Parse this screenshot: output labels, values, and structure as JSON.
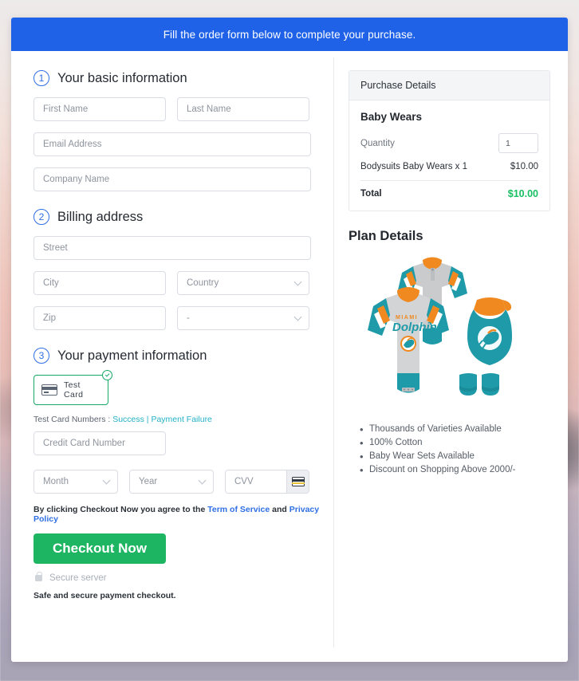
{
  "banner": {
    "text": "Fill the order form below to complete your purchase."
  },
  "steps": [
    {
      "num": "1",
      "title": "Your basic information"
    },
    {
      "num": "2",
      "title": "Billing address"
    },
    {
      "num": "3",
      "title": "Your payment information"
    }
  ],
  "basic_info": {
    "first_name": {
      "placeholder": "First Name",
      "value": ""
    },
    "last_name": {
      "placeholder": "Last Name",
      "value": ""
    },
    "email": {
      "placeholder": "Email Address",
      "value": ""
    },
    "company": {
      "placeholder": "Company Name",
      "value": ""
    }
  },
  "billing": {
    "street": {
      "placeholder": "Street",
      "value": ""
    },
    "city": {
      "placeholder": "City",
      "value": ""
    },
    "country": {
      "placeholder": "Country",
      "value": ""
    },
    "zip": {
      "placeholder": "Zip",
      "value": ""
    },
    "state": {
      "placeholder": "-",
      "value": ""
    }
  },
  "payment": {
    "test_card_label": "Test  Card",
    "test_numbers_prefix": "Test Card Numbers : ",
    "success_link": "Success",
    "link_separator": " | ",
    "failure_link": "Payment Failure",
    "card_number": {
      "placeholder": "Credit Card Number",
      "value": ""
    },
    "month": {
      "placeholder": "Month",
      "value": ""
    },
    "year": {
      "placeholder": "Year",
      "value": ""
    },
    "cvv": {
      "placeholder": "CVV",
      "value": ""
    }
  },
  "agreement": {
    "prefix": "By clicking Checkout Now you agree to the ",
    "terms_link": "Term of Service",
    "middle": " and ",
    "privacy_link": "Privacy Policy"
  },
  "checkout_button": "Checkout Now",
  "secure_label": "Secure server",
  "safe_note": "Safe and secure payment checkout.",
  "purchase": {
    "heading": "Purchase Details",
    "product_title": "Baby Wears",
    "quantity_label": "Quantity",
    "quantity_value": "1",
    "line_item_name": "Bodysuits Baby Wears x 1",
    "line_item_price": "$10.00",
    "total_label": "Total",
    "total_value": "$10.00"
  },
  "plan": {
    "heading": "Plan Details",
    "image_alt": "miami-dolphins-baby-bodysuit-bib-booties-set",
    "features": [
      "Thousands of Varieties Available",
      "100% Cotton",
      "Baby Wear Sets Available",
      "Discount on Shopping Above 2000/-"
    ]
  },
  "colors": {
    "banner_blue": "#1f62e8",
    "step_blue": "#2f6fe4",
    "checkout_green": "#1db561",
    "total_green": "#17c062",
    "test_card_green": "#17a866",
    "link_cyan": "#23b0c6",
    "link_blue": "#2f6fe4"
  }
}
